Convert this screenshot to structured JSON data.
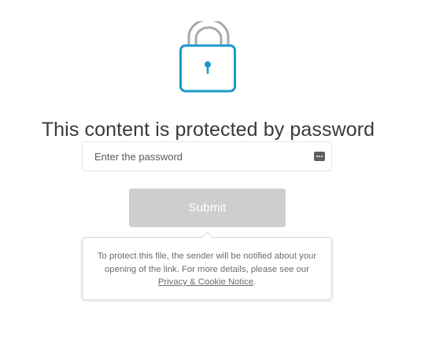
{
  "lock": {
    "icon": "padlock-icon",
    "shackle_color": "#a9a9a9",
    "body_color": "#1b9ac9"
  },
  "title": "This content is protected by password",
  "password": {
    "placeholder": "Enter the password",
    "value": "",
    "keys_icon": "password-manager-icon"
  },
  "submit": {
    "label": "Submit",
    "color": "#cecece"
  },
  "notice": {
    "text_before": "To protect this file, the sender will be notified about your opening of the link. For more details, please see our ",
    "link_text": "Privacy & Cookie Notice",
    "text_after": "."
  }
}
